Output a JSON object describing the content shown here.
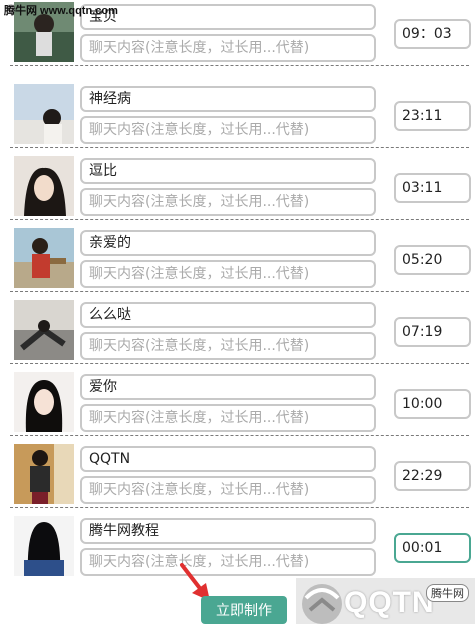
{
  "watermark": "腾牛网 www.qqtn.com",
  "rows": [
    {
      "name": "宝贝",
      "message_placeholder": "聊天内容(注意长度，过长用...代替)",
      "time": "09：03"
    },
    {
      "name": "神经病",
      "message_placeholder": "聊天内容(注意长度，过长用...代替)",
      "time": "23:11"
    },
    {
      "name": "逗比",
      "message_placeholder": "聊天内容(注意长度，过长用...代替)",
      "time": "03:11"
    },
    {
      "name": "亲爱的",
      "message_placeholder": "聊天内容(注意长度，过长用...代替)",
      "time": "05:20"
    },
    {
      "name": "么么哒",
      "message_placeholder": "聊天内容(注意长度，过长用...代替)",
      "time": "07:19"
    },
    {
      "name": "爱你",
      "message_placeholder": "聊天内容(注意长度，过长用...代替)",
      "time": "10:00"
    },
    {
      "name": "QQTN",
      "message_placeholder": "聊天内容(注意长度，过长用...代替)",
      "time": "22:29"
    },
    {
      "name": "腾牛网教程",
      "message_placeholder": "聊天内容(注意长度，过长用...代替)",
      "time": "00:01"
    }
  ],
  "make_button": "立即制作",
  "logo": {
    "text": "QQTN",
    "badge": "腾牛网"
  },
  "colors": {
    "accent": "#4aa792",
    "border": "#c8c8c8",
    "placeholder": "#aaaaaa"
  }
}
